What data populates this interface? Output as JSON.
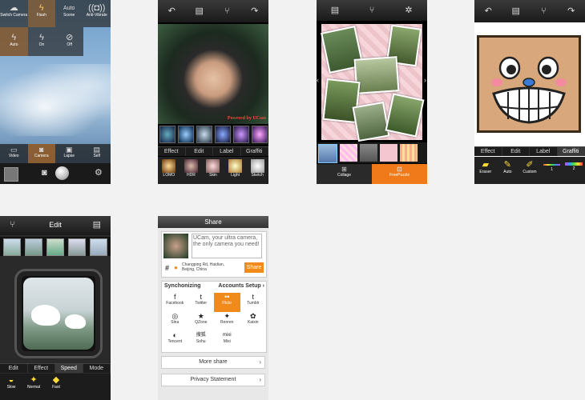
{
  "camera": {
    "top_controls": [
      {
        "label": "Switch Camera",
        "icon": "camera-switch-icon"
      },
      {
        "label": "Flash",
        "icon": "flash-icon"
      },
      {
        "label": "Scene",
        "value": "Auto"
      },
      {
        "label": "Anti-Vibrate",
        "icon": "anti-vibrate-icon"
      }
    ],
    "flash_options": [
      "Auto",
      "On",
      "Off"
    ],
    "modes": [
      "Video",
      "Camera",
      "Lapse",
      "Self"
    ]
  },
  "editor": {
    "tabs": [
      "Effect",
      "Edit",
      "Label",
      "Graffiti"
    ],
    "effects": [
      "LOMO",
      "HDR",
      "Skin",
      "Light",
      "Sketch"
    ],
    "watermark": "Powered by UCam"
  },
  "collage": {
    "tabs": [
      "Collage",
      "FreePuzzle"
    ],
    "active_tab": "FreePuzzle"
  },
  "graffiti": {
    "tabs": [
      "Effect",
      "Edit",
      "Label",
      "Graffiti"
    ],
    "tools": [
      "Eraser",
      "Auto",
      "Custom",
      "1",
      "2"
    ]
  },
  "frame": {
    "title": "Edit",
    "tabs": [
      "Edit",
      "Effect",
      "Speed",
      "Mode"
    ],
    "active_tab": "Speed",
    "speeds": [
      "Slow",
      "Normal",
      "Fast"
    ]
  },
  "share": {
    "title": "Share",
    "message": "UCam, your ultra camera, the only camera you need!",
    "location": "Changping Rd, Haidian, Beijing, China",
    "share_button": "Share",
    "sync_label": "Synchonizing",
    "accounts_label": "Accounts Setup",
    "networks": [
      {
        "name": "Facebook",
        "glyph": "f"
      },
      {
        "name": "Twitter",
        "glyph": "t"
      },
      {
        "name": "Flickr",
        "glyph": "••"
      },
      {
        "name": "Tumblr",
        "glyph": "t"
      },
      {
        "name": "Sina",
        "glyph": "◎"
      },
      {
        "name": "QZone",
        "glyph": "★"
      },
      {
        "name": "Renren",
        "glyph": "✦"
      },
      {
        "name": "Kaixin",
        "glyph": "✿"
      },
      {
        "name": "Tencent",
        "glyph": "◐"
      },
      {
        "name": "Sohu",
        "glyph": "搜狐"
      },
      {
        "name": "Mixi",
        "glyph": "mixi"
      }
    ],
    "selected_network": "Flickr",
    "more_share": "More share",
    "privacy": "Privacy Statement"
  }
}
